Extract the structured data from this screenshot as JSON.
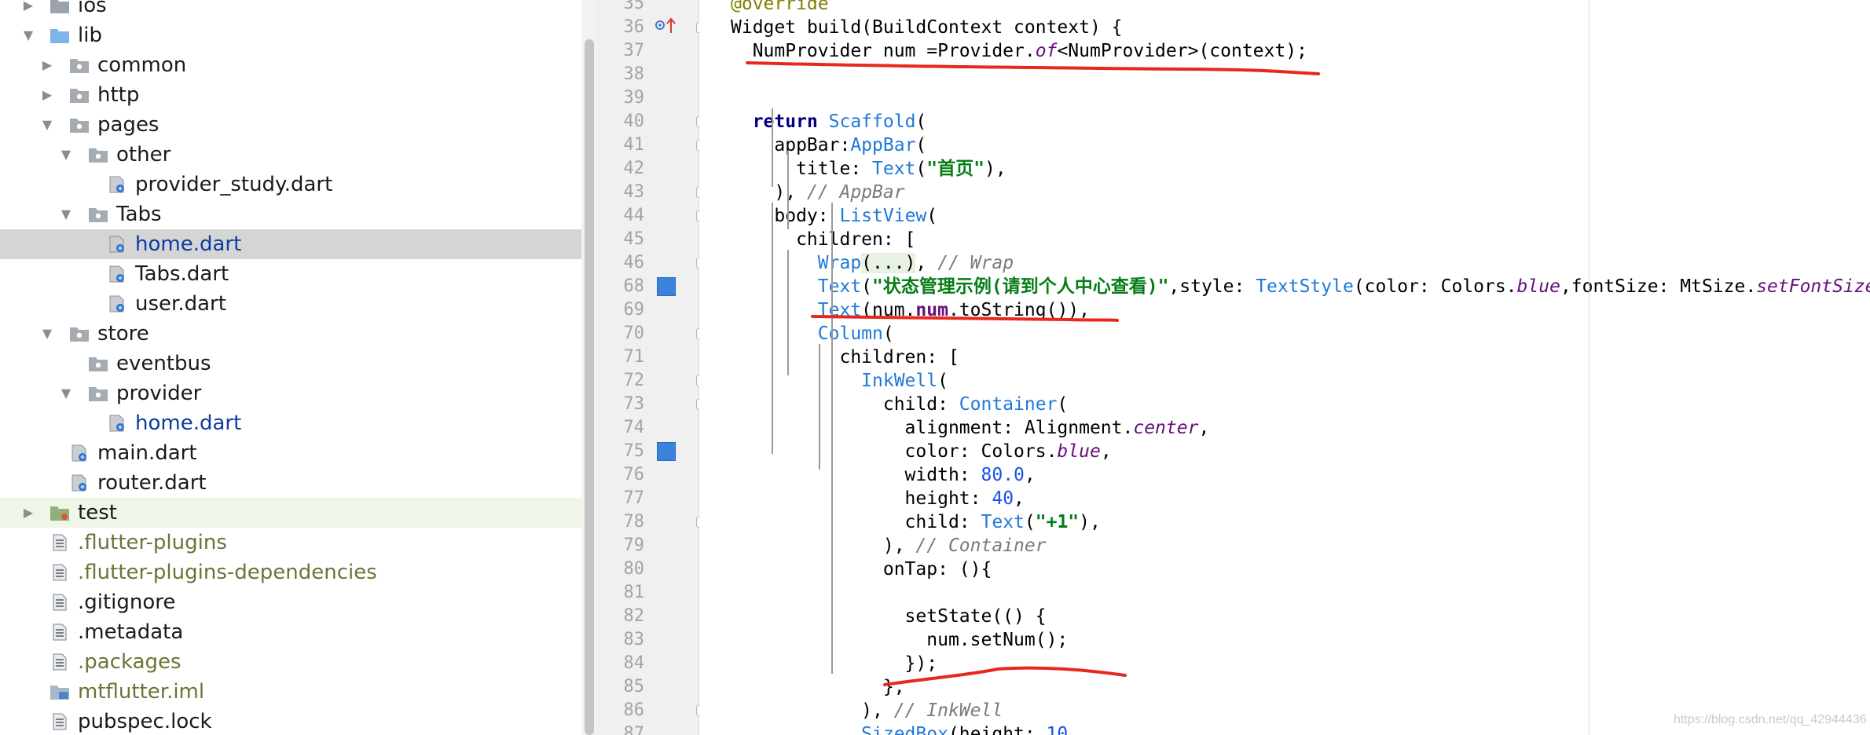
{
  "tree": {
    "items": [
      {
        "label": "ios",
        "arrow": "right",
        "icon": "folder-gray-icon",
        "color": "dark",
        "state": ""
      },
      {
        "label": "lib",
        "arrow": "down",
        "icon": "folder-blue-icon",
        "color": "dark",
        "state": ""
      },
      {
        "label": "common",
        "arrow": "right",
        "icon": "package-icon",
        "color": "dark",
        "state": ""
      },
      {
        "label": "http",
        "arrow": "right",
        "icon": "package-icon",
        "color": "dark",
        "state": ""
      },
      {
        "label": "pages",
        "arrow": "down",
        "icon": "package-icon",
        "color": "dark",
        "state": ""
      },
      {
        "label": "other",
        "arrow": "down",
        "icon": "package-icon",
        "color": "dark",
        "state": ""
      },
      {
        "label": "provider_study.dart",
        "arrow": "",
        "icon": "dart-file-icon",
        "color": "dark",
        "state": ""
      },
      {
        "label": "Tabs",
        "arrow": "down",
        "icon": "package-icon",
        "color": "dark",
        "state": ""
      },
      {
        "label": "home.dart",
        "arrow": "",
        "icon": "dart-file-icon",
        "color": "blue",
        "state": "selected"
      },
      {
        "label": "Tabs.dart",
        "arrow": "",
        "icon": "dart-file-icon",
        "color": "dark",
        "state": ""
      },
      {
        "label": "user.dart",
        "arrow": "",
        "icon": "dart-file-icon",
        "color": "dark",
        "state": ""
      },
      {
        "label": "store",
        "arrow": "down",
        "icon": "package-icon",
        "color": "dark",
        "state": ""
      },
      {
        "label": "eventbus",
        "arrow": "",
        "icon": "package-icon",
        "color": "dark",
        "state": ""
      },
      {
        "label": "provider",
        "arrow": "down",
        "icon": "package-icon",
        "color": "dark",
        "state": ""
      },
      {
        "label": "home.dart",
        "arrow": "",
        "icon": "dart-file-icon",
        "color": "blue",
        "state": ""
      },
      {
        "label": "main.dart",
        "arrow": "",
        "icon": "dart-file-icon",
        "color": "dark",
        "state": ""
      },
      {
        "label": "router.dart",
        "arrow": "",
        "icon": "dart-file-icon",
        "color": "dark",
        "state": ""
      },
      {
        "label": "test",
        "arrow": "right",
        "icon": "test-folder-icon",
        "color": "dark",
        "state": "hl"
      },
      {
        "label": ".flutter-plugins",
        "arrow": "",
        "icon": "text-file-icon",
        "color": "olive",
        "state": ""
      },
      {
        "label": ".flutter-plugins-dependencies",
        "arrow": "",
        "icon": "text-file-icon",
        "color": "olive",
        "state": ""
      },
      {
        "label": ".gitignore",
        "arrow": "",
        "icon": "text-file-icon",
        "color": "dark",
        "state": ""
      },
      {
        "label": ".metadata",
        "arrow": "",
        "icon": "text-file-icon",
        "color": "dark",
        "state": ""
      },
      {
        "label": ".packages",
        "arrow": "",
        "icon": "text-file-icon",
        "color": "olive",
        "state": ""
      },
      {
        "label": "mtflutter.iml",
        "arrow": "",
        "icon": "iml-file-icon",
        "color": "olive",
        "state": ""
      },
      {
        "label": "pubspec.lock",
        "arrow": "",
        "icon": "text-file-icon",
        "color": "dark",
        "state": ""
      }
    ]
  },
  "editor": {
    "lines": [
      {
        "n": "35",
        "tokens": [
          {
            "t": "@override",
            "c": "ann"
          }
        ]
      },
      {
        "n": "36",
        "tokens": [
          {
            "t": "Widget "
          },
          {
            "t": "build"
          },
          {
            "t": "(BuildContext context) {"
          }
        ]
      },
      {
        "n": "37",
        "tokens": [
          {
            "t": "  NumProvider num =Provider."
          },
          {
            "t": "of",
            "c": "fld"
          },
          {
            "t": "<NumProvider>(context);"
          }
        ]
      },
      {
        "n": "38",
        "tokens": []
      },
      {
        "n": "39",
        "tokens": []
      },
      {
        "n": "40",
        "tokens": [
          {
            "t": "  "
          },
          {
            "t": "return ",
            "c": "kw"
          },
          {
            "t": "Scaffold",
            "c": "cls"
          },
          {
            "t": "("
          }
        ]
      },
      {
        "n": "41",
        "tokens": [
          {
            "t": "    appBar:"
          },
          {
            "t": "AppBar",
            "c": "cls"
          },
          {
            "t": "("
          }
        ]
      },
      {
        "n": "42",
        "tokens": [
          {
            "t": "      title: "
          },
          {
            "t": "Text",
            "c": "cls"
          },
          {
            "t": "("
          },
          {
            "t": "\"首页\"",
            "c": "str"
          },
          {
            "t": "),"
          }
        ]
      },
      {
        "n": "43",
        "tokens": [
          {
            "t": "    ), "
          },
          {
            "t": "// AppBar",
            "c": "cmt"
          }
        ]
      },
      {
        "n": "44",
        "tokens": [
          {
            "t": "    body: "
          },
          {
            "t": "ListView",
            "c": "cls"
          },
          {
            "t": "("
          }
        ]
      },
      {
        "n": "45",
        "tokens": [
          {
            "t": "      children: ["
          }
        ]
      },
      {
        "n": "46",
        "tokens": [
          {
            "t": "        "
          },
          {
            "t": "Wrap",
            "c": "cls"
          },
          {
            "t": "(...)",
            "c": "folded"
          },
          {
            "t": ", "
          },
          {
            "t": "// Wrap",
            "c": "cmt"
          }
        ]
      },
      {
        "n": "68",
        "tokens": [
          {
            "t": "        "
          },
          {
            "t": "Text",
            "c": "cls"
          },
          {
            "t": "("
          },
          {
            "t": "\"状态管理示例(请到个人中心查看)\"",
            "c": "str"
          },
          {
            "t": ",style: "
          },
          {
            "t": "TextStyle",
            "c": "cls"
          },
          {
            "t": "(color: Colors."
          },
          {
            "t": "blue",
            "c": "fld"
          },
          {
            "t": ",fontSize: MtSize."
          },
          {
            "t": "setFontSize",
            "c": "fld"
          }
        ]
      },
      {
        "n": "69",
        "tokens": [
          {
            "t": "        "
          },
          {
            "t": "Text",
            "c": "cls"
          },
          {
            "t": "(num."
          },
          {
            "t": "num",
            "c": "pfld"
          },
          {
            "t": ".toString()),"
          }
        ]
      },
      {
        "n": "70",
        "tokens": [
          {
            "t": "        "
          },
          {
            "t": "Column",
            "c": "cls"
          },
          {
            "t": "("
          }
        ]
      },
      {
        "n": "71",
        "tokens": [
          {
            "t": "          children: ["
          }
        ]
      },
      {
        "n": "72",
        "tokens": [
          {
            "t": "            "
          },
          {
            "t": "InkWell",
            "c": "cls"
          },
          {
            "t": "("
          }
        ]
      },
      {
        "n": "73",
        "tokens": [
          {
            "t": "              child: "
          },
          {
            "t": "Container",
            "c": "cls"
          },
          {
            "t": "("
          }
        ]
      },
      {
        "n": "74",
        "tokens": [
          {
            "t": "                alignment: Alignment."
          },
          {
            "t": "center",
            "c": "fld"
          },
          {
            "t": ","
          }
        ]
      },
      {
        "n": "75",
        "tokens": [
          {
            "t": "                color: Colors."
          },
          {
            "t": "blue",
            "c": "fld"
          },
          {
            "t": ","
          }
        ]
      },
      {
        "n": "76",
        "tokens": [
          {
            "t": "                width: "
          },
          {
            "t": "80.0",
            "c": "num"
          },
          {
            "t": ","
          }
        ]
      },
      {
        "n": "77",
        "tokens": [
          {
            "t": "                height: "
          },
          {
            "t": "40",
            "c": "num"
          },
          {
            "t": ","
          }
        ]
      },
      {
        "n": "78",
        "tokens": [
          {
            "t": "                child: "
          },
          {
            "t": "Text",
            "c": "cls"
          },
          {
            "t": "("
          },
          {
            "t": "\"+1\"",
            "c": "str"
          },
          {
            "t": "),"
          }
        ]
      },
      {
        "n": "79",
        "tokens": [
          {
            "t": "              ), "
          },
          {
            "t": "// Container",
            "c": "cmt"
          }
        ]
      },
      {
        "n": "80",
        "tokens": [
          {
            "t": "              onTap: (){"
          }
        ]
      },
      {
        "n": "81",
        "tokens": []
      },
      {
        "n": "82",
        "tokens": [
          {
            "t": "                setState(() {"
          }
        ]
      },
      {
        "n": "83",
        "tokens": [
          {
            "t": "                  num.setNum();"
          }
        ]
      },
      {
        "n": "84",
        "tokens": [
          {
            "t": "                });"
          }
        ]
      },
      {
        "n": "85",
        "tokens": [
          {
            "t": "              },"
          }
        ]
      },
      {
        "n": "86",
        "tokens": [
          {
            "t": "            ), "
          },
          {
            "t": "// InkWell",
            "c": "cmt"
          }
        ]
      },
      {
        "n": "87",
        "tokens": [
          {
            "t": "            "
          },
          {
            "t": "SizedBox",
            "c": "cls"
          },
          {
            "t": "(height: "
          },
          {
            "t": "10",
            "c": "num"
          },
          {
            "t": ","
          }
        ]
      }
    ]
  },
  "watermark": "https://blog.csdn.net/qq_42944436",
  "colors": {
    "selected_row": "#d5d5d5",
    "highlight_row": "#eef6e8",
    "annotation_red": "#e8281e",
    "breakpoint": "#3b82dc"
  }
}
